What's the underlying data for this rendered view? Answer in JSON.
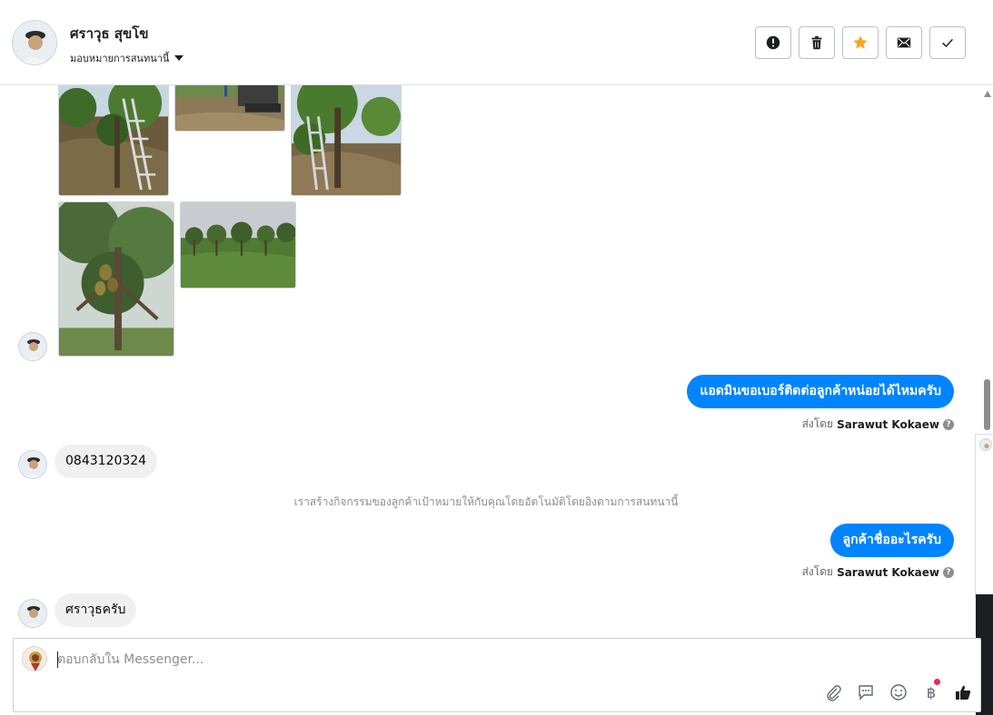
{
  "header": {
    "contact_name": "ศราวุธ สุขโข",
    "assign_label": "มอบหมายการสนทนานี้",
    "actions": [
      {
        "name": "spam-button",
        "icon": "alert-icon"
      },
      {
        "name": "delete-button",
        "icon": "trash-icon"
      },
      {
        "name": "star-button",
        "icon": "star-icon"
      },
      {
        "name": "mark-unread-button",
        "icon": "envelope-icon"
      },
      {
        "name": "done-button",
        "icon": "checkmark-icon"
      }
    ]
  },
  "messages": [
    {
      "direction": "out",
      "text": "แอดมินขอเบอร์ติดต่อลูกค้าหน่อยได้ไหมครับ",
      "sent_by_prefix": "ส่งโดย",
      "sent_by_name": "Sarawut Kokaew"
    },
    {
      "direction": "in",
      "text": "0843120324"
    },
    {
      "direction": "system",
      "text": "เราสร้างกิจกรรมของลูกค้าเป้าหมายให้กับคุณโดยอัตโนมัติโดยอิงตามการสนทนานี้"
    },
    {
      "direction": "out",
      "text": "ลูกค้าชื่ออะไรครับ",
      "sent_by_prefix": "ส่งโดย",
      "sent_by_name": "Sarawut Kokaew"
    },
    {
      "direction": "in",
      "text": "ศราวุธครับ"
    }
  ],
  "photos": {
    "count": 5,
    "subject": "durian orchard photos"
  },
  "composer": {
    "placeholder": "ตอบกลับใน Messenger...",
    "tools": [
      "paperclip-icon",
      "message-icon",
      "emoji-icon",
      "baht-icon",
      "thumbs-up-icon"
    ],
    "baht_symbol": "฿"
  },
  "colors": {
    "accent": "#0084ff",
    "star": "#f5a623",
    "incoming_bubble": "#f0f0f0",
    "notification_dot": "#f02849"
  }
}
